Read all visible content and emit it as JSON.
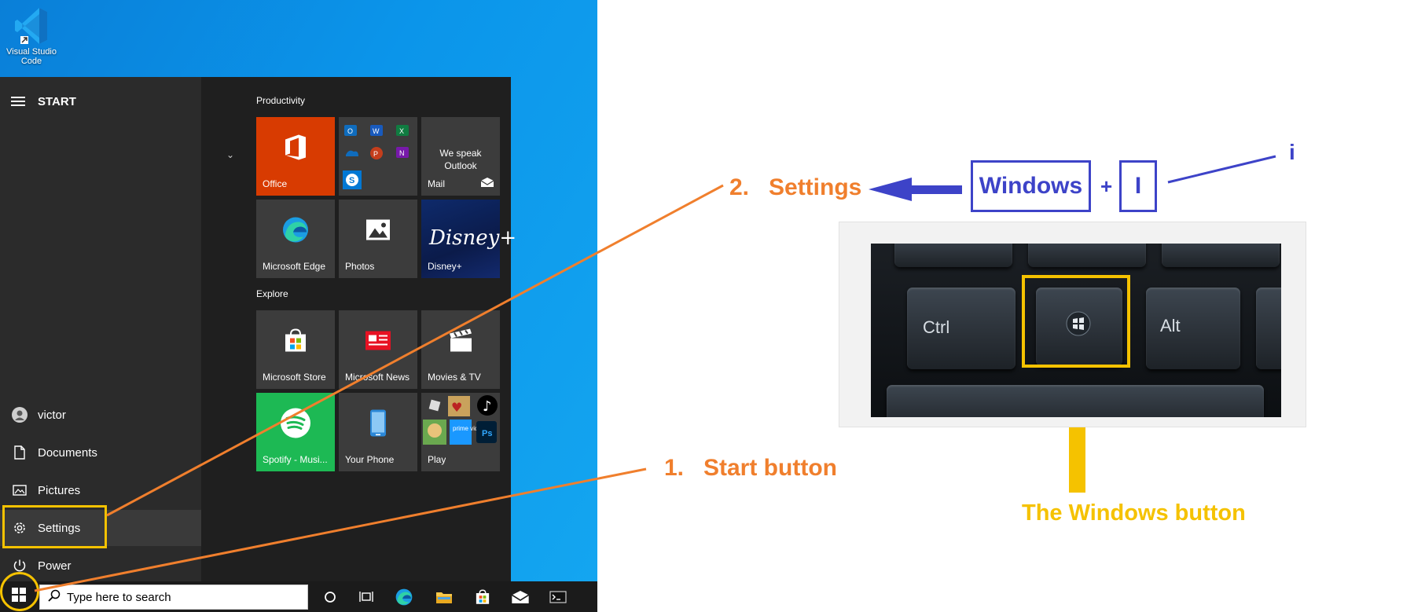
{
  "desktop": {
    "icons": [
      {
        "label": "Visual Studio Code",
        "icon": "vscode-icon"
      }
    ]
  },
  "start_menu": {
    "header": "START",
    "nav": {
      "user": "victor",
      "documents": "Documents",
      "pictures": "Pictures",
      "settings": "Settings",
      "power": "Power"
    },
    "groups": {
      "productivity": "Productivity",
      "explore": "Explore"
    },
    "tiles": {
      "office": "Office",
      "mail_heading": "We speak Outlook",
      "mail": "Mail",
      "edge": "Microsoft Edge",
      "photos": "Photos",
      "disney_logo": "Disney+",
      "disney": "Disney+",
      "store": "Microsoft Store",
      "news": "Microsoft News",
      "movies": "Movies & TV",
      "spotify": "Spotify - Musi...",
      "your_phone": "Your Phone",
      "play": "Play",
      "play_tile_text": {
        "prime": "prime video",
        "ps": "Ps"
      }
    }
  },
  "taskbar": {
    "search_placeholder": "Type here to search",
    "icons": [
      "windows-start-icon",
      "search-icon",
      "cortana-icon",
      "task-view-icon",
      "edge-icon",
      "file-explorer-icon",
      "store-icon",
      "mail-icon",
      "terminal-icon"
    ]
  },
  "annotations": {
    "step2_number": "2.",
    "step2": "Settings",
    "step1_number": "1.",
    "step1": "Start button",
    "key_windows": "Windows",
    "plus": "+",
    "key_i": "I",
    "lower_i": "i",
    "windows_button": "The Windows button",
    "keys": {
      "ctrl": "Ctrl",
      "alt": "Alt"
    }
  },
  "colors": {
    "annotation_orange": "#f07f2d",
    "annotation_blue": "#3d43c8",
    "annotation_yellow": "#f5c200",
    "office_tile": "#d83b01",
    "spotify_tile": "#1db954",
    "disney_tile": "#0b1b4a"
  }
}
